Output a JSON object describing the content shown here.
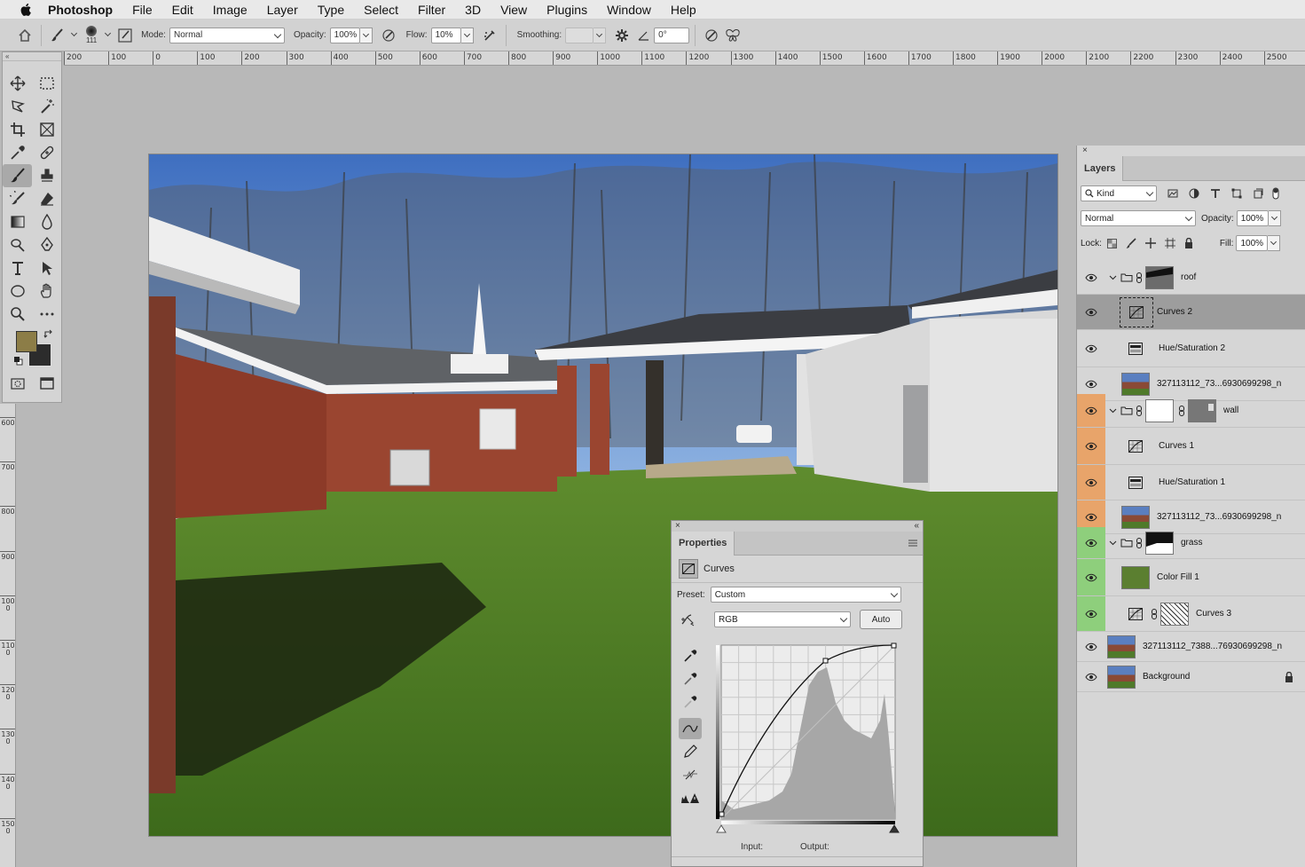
{
  "menubar": {
    "app": "Photoshop",
    "items": [
      "File",
      "Edit",
      "Image",
      "Layer",
      "Type",
      "Select",
      "Filter",
      "3D",
      "View",
      "Plugins",
      "Window",
      "Help"
    ]
  },
  "options": {
    "brush_size": "111",
    "mode_label": "Mode:",
    "mode_value": "Normal",
    "opacity_label": "Opacity:",
    "opacity_value": "100%",
    "flow_label": "Flow:",
    "flow_value": "10%",
    "smoothing_label": "Smoothing:",
    "smoothing_value": "",
    "angle_value": "0°"
  },
  "ruler": {
    "labels": [
      "200",
      "100",
      "0",
      "100",
      "200",
      "300",
      "400",
      "500",
      "600",
      "700",
      "800",
      "900",
      "1000",
      "1100",
      "1200",
      "1300",
      "1400",
      "1500",
      "1600",
      "1700",
      "1800",
      "1900",
      "2000",
      "2100",
      "2200",
      "2300",
      "2400",
      "2500"
    ]
  },
  "vruler": {
    "labels": [
      "600",
      "700",
      "800",
      "900",
      "1000",
      "1100",
      "1200",
      "1300",
      "1400",
      "1500"
    ]
  },
  "colors": {
    "foreground": "#8c7d47",
    "background": "#2c2c2c",
    "tag_orange": "#e8a46a",
    "tag_green": "#8ecf7c"
  },
  "layers": {
    "tab": "Layers",
    "filter_kind": "Kind",
    "blend_mode": "Normal",
    "opacity_label": "Opacity:",
    "opacity_value": "100%",
    "lock_label": "Lock:",
    "fill_label": "Fill:",
    "fill_value": "100%",
    "rows": [
      {
        "name": "roof",
        "kind": "group",
        "tag": "none"
      },
      {
        "name": "Curves 2",
        "kind": "curves",
        "tag": "none",
        "selected": true
      },
      {
        "name": "Hue/Saturation 2",
        "kind": "huesat",
        "tag": "none"
      },
      {
        "name": "327113112_73...6930699298_n",
        "kind": "smart",
        "tag": "none"
      },
      {
        "name": "wall",
        "kind": "group",
        "tag": "orange"
      },
      {
        "name": "Curves 1",
        "kind": "curves",
        "tag": "orange"
      },
      {
        "name": "Hue/Saturation 1",
        "kind": "huesat",
        "tag": "orange"
      },
      {
        "name": "327113112_73...6930699298_n",
        "kind": "smart",
        "tag": "orange"
      },
      {
        "name": "grass",
        "kind": "group",
        "tag": "green"
      },
      {
        "name": "Color Fill 1",
        "kind": "fill",
        "tag": "green"
      },
      {
        "name": "Curves 3",
        "kind": "curves-mask",
        "tag": "green"
      },
      {
        "name": "327113112_7388...76930699298_n",
        "kind": "smart",
        "tag": "none"
      },
      {
        "name": "Background",
        "kind": "background",
        "tag": "none"
      }
    ]
  },
  "properties": {
    "tab": "Properties",
    "adjustment": "Curves",
    "preset_label": "Preset:",
    "preset_value": "Custom",
    "channel_value": "RGB",
    "auto_button": "Auto",
    "input_label": "Input:",
    "output_label": "Output:"
  }
}
